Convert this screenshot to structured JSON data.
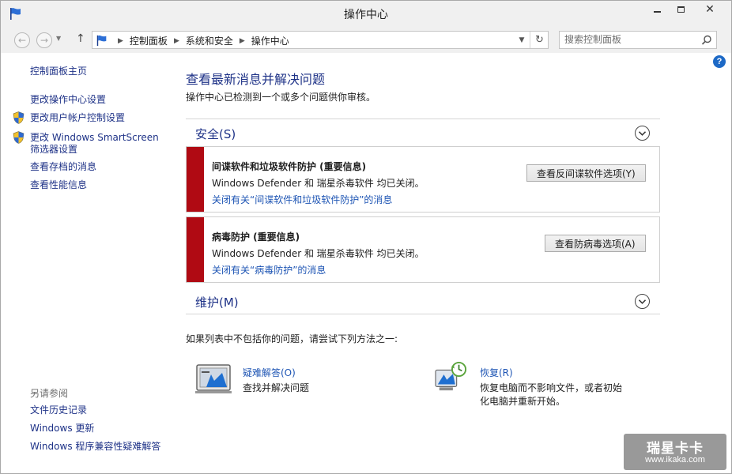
{
  "window": {
    "title": "操作中心"
  },
  "address_bar": {
    "breadcrumbs": [
      "控制面板",
      "系统和安全",
      "操作中心"
    ]
  },
  "search": {
    "placeholder": "搜索控制面板"
  },
  "sidebar": {
    "home": "控制面板主页",
    "links": [
      {
        "label": "更改操作中心设置",
        "shield": false
      },
      {
        "label": "更改用户帐户控制设置",
        "shield": true
      },
      {
        "label_line1": "更改 Windows SmartScreen",
        "label_line2": "筛选器设置",
        "shield": true
      },
      {
        "label": "查看存档的消息",
        "shield": false
      },
      {
        "label": "查看性能信息",
        "shield": false
      }
    ],
    "see_also": {
      "heading": "另请参阅",
      "links": [
        "文件历史记录",
        "Windows 更新",
        "Windows 程序兼容性疑难解答"
      ]
    }
  },
  "main": {
    "title": "查看最新消息并解决问题",
    "subtitle": "操作中心已检测到一个或多个问题供你审核。",
    "security": {
      "label": "安全(S)",
      "alerts": [
        {
          "title": "间谍软件和垃圾软件防护 (重要信息)",
          "body": "Windows Defender 和 瑞星杀毒软件 均已关闭。",
          "link": "关闭有关“间谍软件和垃圾软件防护”的消息",
          "button": "查看反间谍软件选项(Y)"
        },
        {
          "title": "病毒防护 (重要信息)",
          "body": "Windows Defender 和 瑞星杀毒软件 均已关闭。",
          "link": "关闭有关“病毒防护”的消息",
          "button": "查看防病毒选项(A)"
        }
      ]
    },
    "maintenance": {
      "label": "维护(M)"
    },
    "hint": "如果列表中不包括你的问题，请尝试下列方法之一:",
    "options": [
      {
        "title": "疑难解答(O)",
        "desc": "查找并解决问题"
      },
      {
        "title": "恢复(R)",
        "desc_line1": "恢复电脑而不影响文件，或者初始",
        "desc_line2": "化电脑并重新开始。"
      }
    ]
  },
  "watermark": {
    "line1": "瑞星卡卡",
    "line2": "www.ikaka.com"
  },
  "colors": {
    "link_blue": "#1e3287",
    "alert_red": "#b00a13",
    "accent_blue": "#1d69c6"
  }
}
